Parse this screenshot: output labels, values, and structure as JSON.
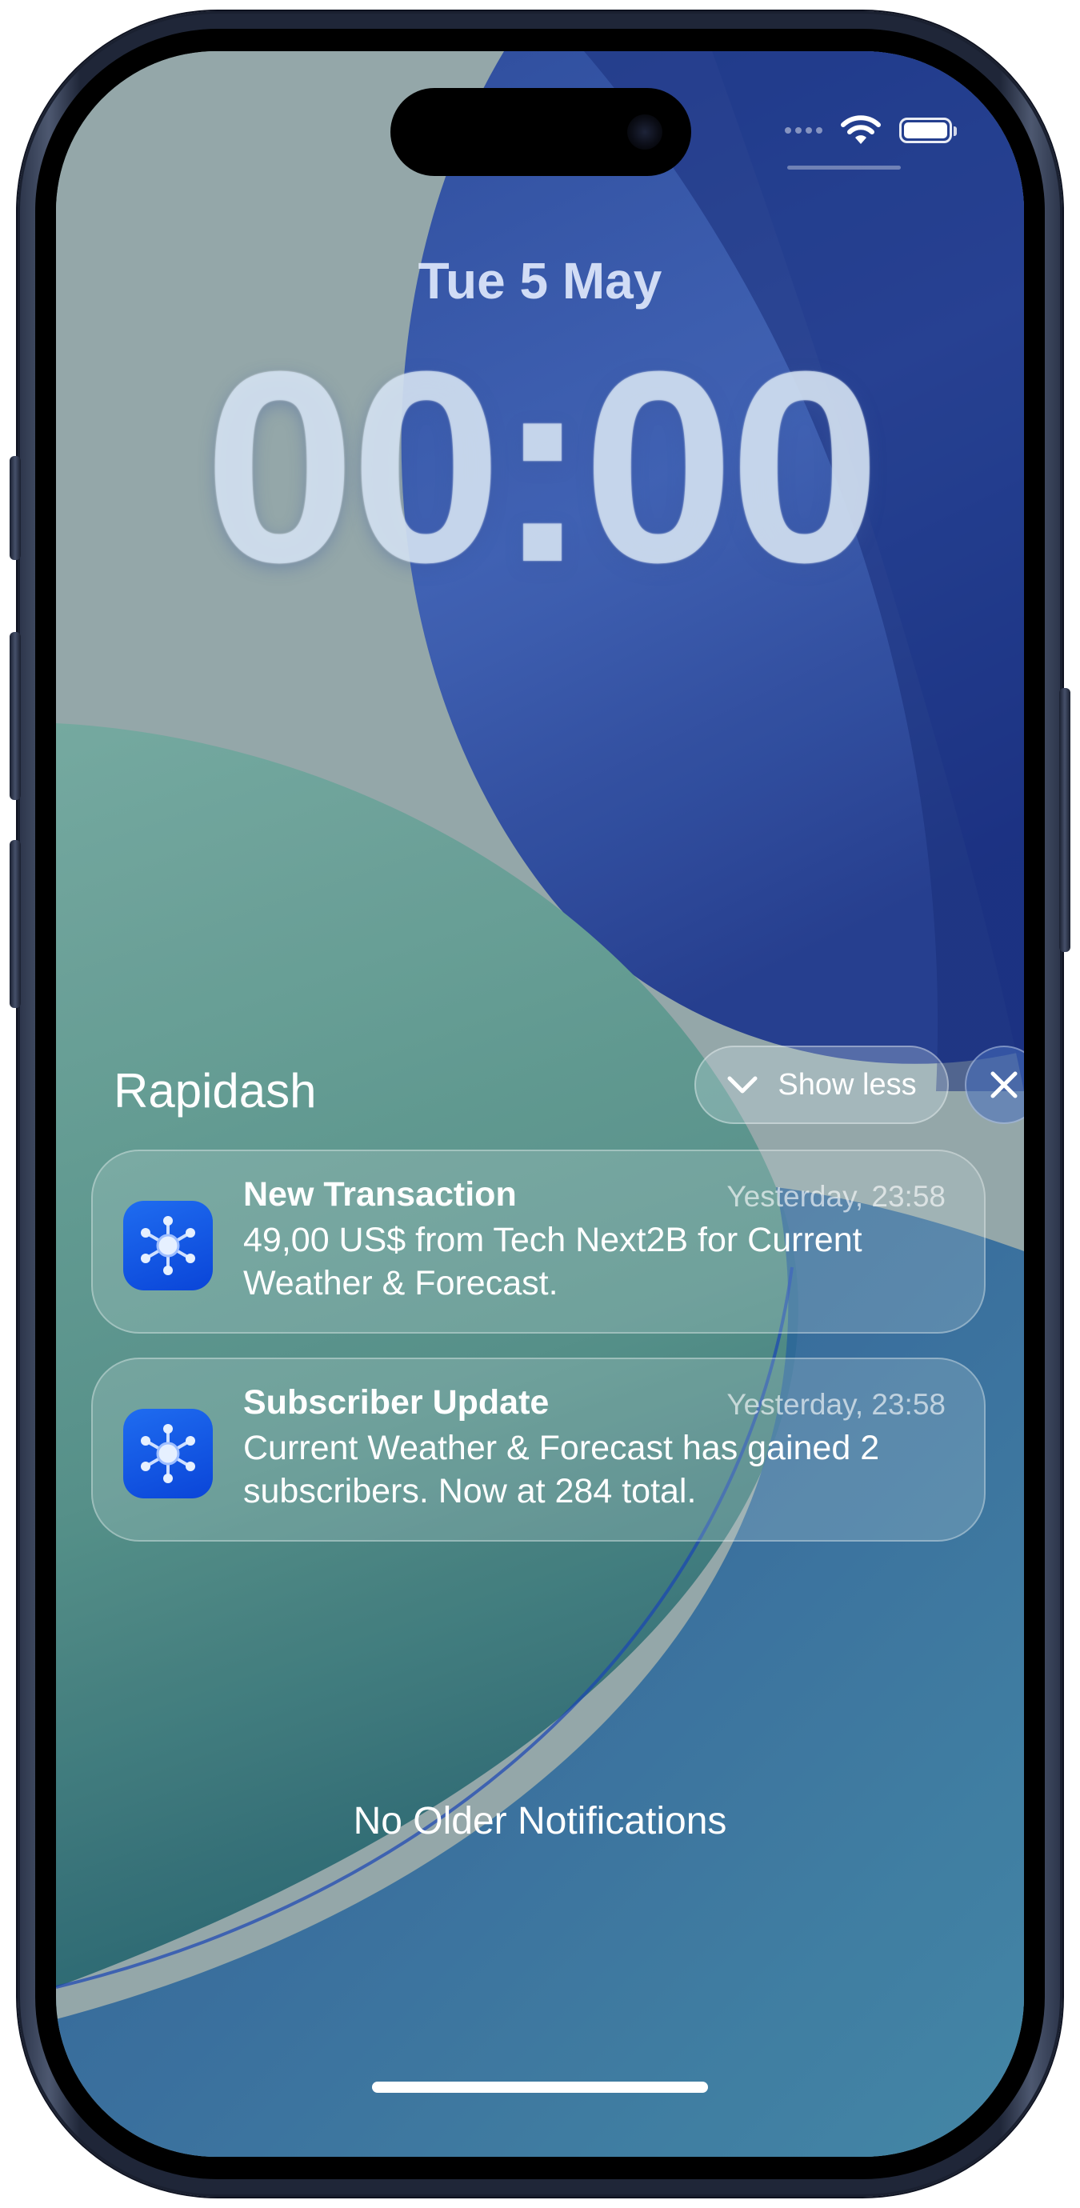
{
  "lock_screen": {
    "date": "Tue 5 May",
    "time": "00:00"
  },
  "status_bar": {
    "icons": [
      "signal-icon",
      "wifi-icon",
      "battery-icon"
    ],
    "battery_level": 1.0
  },
  "notification_group": {
    "app_name": "Rapidash",
    "show_less_label": "Show less",
    "icons": {
      "chevron": "chevron-down-icon",
      "close": "close-icon",
      "app": "network-hub-icon"
    },
    "app_icon_color": "#0a45d8",
    "notifications": [
      {
        "title": "New Transaction",
        "time": "Yesterday, 23:58",
        "body": "49,00 US$ from Tech Next2B for Current Weather & Forecast."
      },
      {
        "title": "Subscriber Update",
        "time": "Yesterday, 23:58",
        "body": "Current Weather & Forecast has gained 2 subscribers. Now at 284 total."
      }
    ]
  },
  "footer": {
    "no_older_label": "No Older Notifications"
  }
}
